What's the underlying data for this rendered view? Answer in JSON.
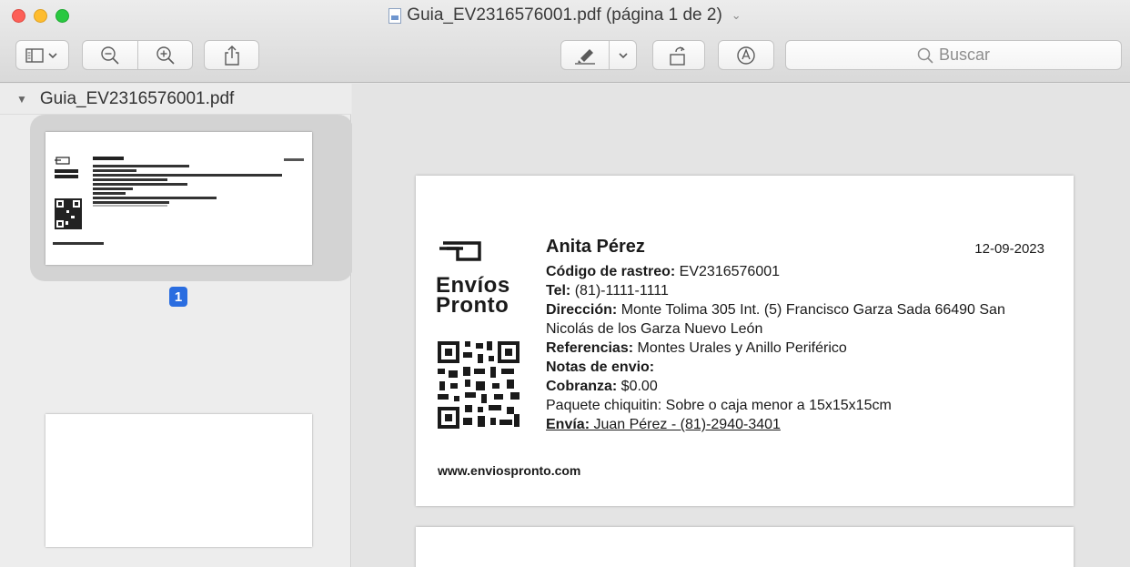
{
  "window": {
    "title": "Guia_EV2316576001.pdf (página 1 de 2)",
    "title_chevron": "⌄"
  },
  "toolbar": {
    "search_placeholder": "Buscar",
    "search_icon": "magnifier-icon"
  },
  "sidebar": {
    "file_name": "Guia_EV2316576001.pdf",
    "disclosure": "▼",
    "page_badge": "1"
  },
  "document": {
    "logo": "Envíos\nPronto",
    "recipient": "Anita Pérez",
    "date": "12-09-2023",
    "tracking_label": "Código de rastreo:",
    "tracking_value": " EV2316576001",
    "tel_label": "Tel:",
    "tel_value": " (81)-1111-1111",
    "address_label": "Dirección:",
    "address_value": " Monte Tolima 305 Int. (5) Francisco Garza Sada 66490 San",
    "address_value2": "Nicolás de los Garza Nuevo León",
    "references_label": "Referencias:",
    "references_value": " Montes Urales y Anillo Periférico",
    "notes_label": "Notas de envio:",
    "charge_label": "Cobranza:",
    "charge_value": " $0.00",
    "package": "Paquete chiquitin: Sobre o caja menor a 15x15x15cm",
    "sender_label": "Envía:",
    "sender_value": " Juan Pérez - (81)-2940-3401 ",
    "website": "www.enviospronto.com"
  }
}
